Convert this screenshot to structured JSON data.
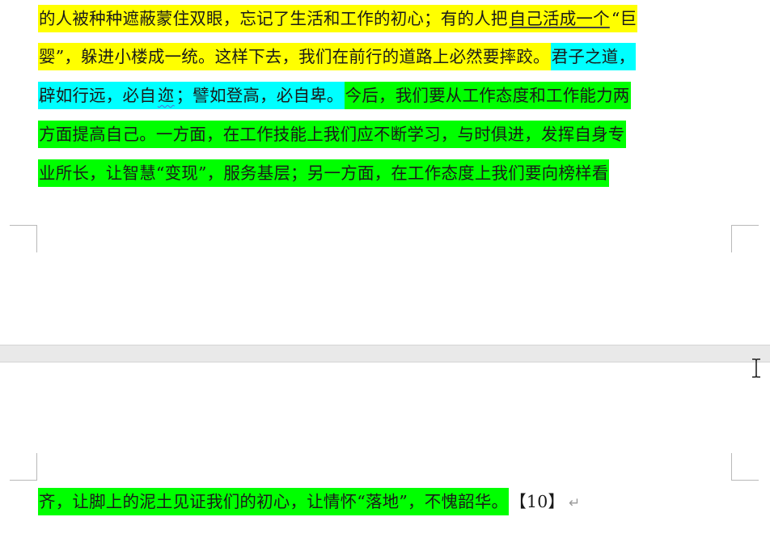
{
  "document": {
    "page1_lines": [
      [
        {
          "text": "的人被种种遮蔽蒙住双眼，忘记了生活和工作的初心；有的人把",
          "hl": "yellow"
        },
        {
          "text": "自己活成一个",
          "hl": "yellow",
          "style": "underline"
        },
        {
          "text": "“巨",
          "hl": "yellow"
        }
      ],
      [
        {
          "text": "婴”，躲进小楼成一统。这样下去，我们在前行的道路上必然要摔跤。",
          "hl": "yellow"
        },
        {
          "text": "君子之道，",
          "hl": "cyan"
        }
      ],
      [
        {
          "text": "辟如行远，必自",
          "hl": "cyan"
        },
        {
          "text": "迩",
          "hl": "cyan",
          "style": "squiggle"
        },
        {
          "text": "；譬如登高，必自卑。",
          "hl": "cyan"
        },
        {
          "text": "今后，我们要从工作态度和工作能力两",
          "hl": "green"
        }
      ],
      [
        {
          "text": "方面提高自己。一方面，在工作技能上我们应不断学习，与时俱进，发挥自身专",
          "hl": "green"
        }
      ],
      [
        {
          "text": "业所长，让智慧“变现”，服务基层；另一方面，在工作态度上我们要向榜样看",
          "hl": "green"
        }
      ]
    ],
    "page2_lines": [
      [
        {
          "text": "齐，让脚上的泥土见证我们的初心，让情怀“落地”，不愧韶华。",
          "hl": "green"
        },
        {
          "text": "【10】",
          "hl": "none"
        }
      ]
    ],
    "paragraph_mark": "↵"
  },
  "colors": {
    "yellow": "#ffff00",
    "cyan": "#00ffff",
    "green": "#00ff00",
    "page_gap": "#e9e9e9"
  },
  "icons": {
    "cursor": "text-ibeam-cursor-icon",
    "paragraph_mark": "paragraph-mark-icon"
  }
}
